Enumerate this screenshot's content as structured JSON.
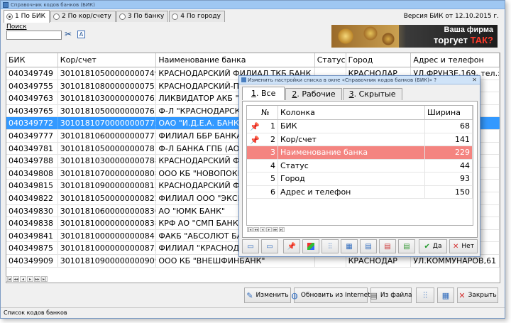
{
  "window": {
    "title": "Справочник кодов банков (БИК)"
  },
  "tabs": [
    {
      "label": "1 По БИК",
      "active": true
    },
    {
      "label": "2 По кор/счету",
      "active": false
    },
    {
      "label": "3 По банку",
      "active": false
    },
    {
      "label": "4 По городу",
      "active": false
    }
  ],
  "version": "Версия БИК от 12.10.2015 г.",
  "search": {
    "label": "Поиск",
    "value": "",
    "a_label": "A"
  },
  "ad": {
    "line1": "Ваша фирма",
    "line2_prefix": "торгует",
    "line2_highlight": "ТАК?"
  },
  "grid": {
    "columns": [
      "БИК",
      "Кор/счет",
      "Наименование банка",
      "Статус",
      "Город",
      "Адрес и телефон"
    ],
    "selected_index": 4,
    "rows": [
      [
        "040349749",
        "30101810500000000749",
        "КРАСНОДАРСКИЙ ФИЛИАЛ ТКБ БАНК ПА",
        "",
        "КРАСНОДАР",
        "УЛ.ФРУНЗЕ,169, тел.:"
      ],
      [
        "040349755",
        "30101810800000000755",
        "КРАСНОДАРСКИЙ-ПК",
        "",
        "",
        ""
      ],
      [
        "040349763",
        "30101810300000000763",
        "ЛИКВИДАТОР АКБ \"ЭК",
        "",
        "",
        ""
      ],
      [
        "040349765",
        "30101810500000000765",
        "Ф-Л \"КРАСНОДАРСКИ",
        "",
        "",
        ""
      ],
      [
        "040349772",
        "30101810700000000772",
        "ОАО \"И.Д.Е.А. БАНК\"",
        "",
        "",
        ""
      ],
      [
        "040349777",
        "30101810600000000777",
        "ФИЛИАЛ ББР БАНКА (А",
        "",
        "",
        ""
      ],
      [
        "040349781",
        "30101810500000000781",
        "Ф-Л БАНКА ГПБ (АО) В",
        "",
        "",
        ""
      ],
      [
        "040349788",
        "30101810300000000788",
        "КРАСНОДАРСКИЙ ФИЛ",
        "",
        "",
        ""
      ],
      [
        "040349808",
        "30101810700000000808",
        "ООО КБ \"НОВОПОКРО",
        "",
        "",
        ""
      ],
      [
        "040349815",
        "30101810900000000815",
        "КРАСНОДАРСКИЙ ФИЛ",
        "",
        "",
        ""
      ],
      [
        "040349822",
        "30101810500000000822",
        "ФИЛИАЛ ООО \"ЭКСПО",
        "",
        "",
        ""
      ],
      [
        "040349830",
        "30101810600000000830",
        "АО \"ЮМК БАНК\"",
        "",
        "",
        ""
      ],
      [
        "040349838",
        "30101810000000000838",
        "КРФ АО \"СМП БАНК\"",
        "",
        "",
        ""
      ],
      [
        "040349841",
        "30101810000000000841",
        "ФАКБ \"АБСОЛЮТ БАНК",
        "",
        "",
        ""
      ],
      [
        "040349875",
        "30101810000000000875",
        "ФИЛИАЛ \"КРАСНОДАР",
        "",
        "",
        ""
      ],
      [
        "040349909",
        "30101810900000000909",
        "ООО КБ \"ВНЕШФИНБАНК\"",
        "",
        "КРАСНОДАР",
        "УЛ.КОММУНАРОВ,61"
      ]
    ]
  },
  "buttons": {
    "edit": "Изменить",
    "update": "Обновить из Internet",
    "from_file": "Из файла",
    "close": "Закрыть"
  },
  "statusbar": "Список кодов банков",
  "dialog": {
    "title": "Изменить настройки списка в окне «Справочник кодов банков (БИК)» ?",
    "tabs": [
      {
        "num": "1",
        "label": ". Все",
        "active": true
      },
      {
        "num": "2",
        "label": ". Рабочие",
        "active": false
      },
      {
        "num": "3",
        "label": ". Скрытые",
        "active": false
      }
    ],
    "columns": [
      "№",
      "Колонка",
      "Ширина"
    ],
    "selected_index": 2,
    "rows": [
      {
        "num": "1",
        "name": "БИК",
        "width": "68",
        "pinned": true
      },
      {
        "num": "2",
        "name": "Кор/счет",
        "width": "141",
        "pinned": true
      },
      {
        "num": "3",
        "name": "Наименование банка",
        "width": "229",
        "pinned": false
      },
      {
        "num": "4",
        "name": "Статус",
        "width": "44",
        "pinned": false
      },
      {
        "num": "5",
        "name": "Город",
        "width": "93",
        "pinned": false
      },
      {
        "num": "6",
        "name": "Адрес и телефон",
        "width": "150",
        "pinned": false
      }
    ],
    "ok_label": "Да",
    "cancel_label": "Нет"
  }
}
